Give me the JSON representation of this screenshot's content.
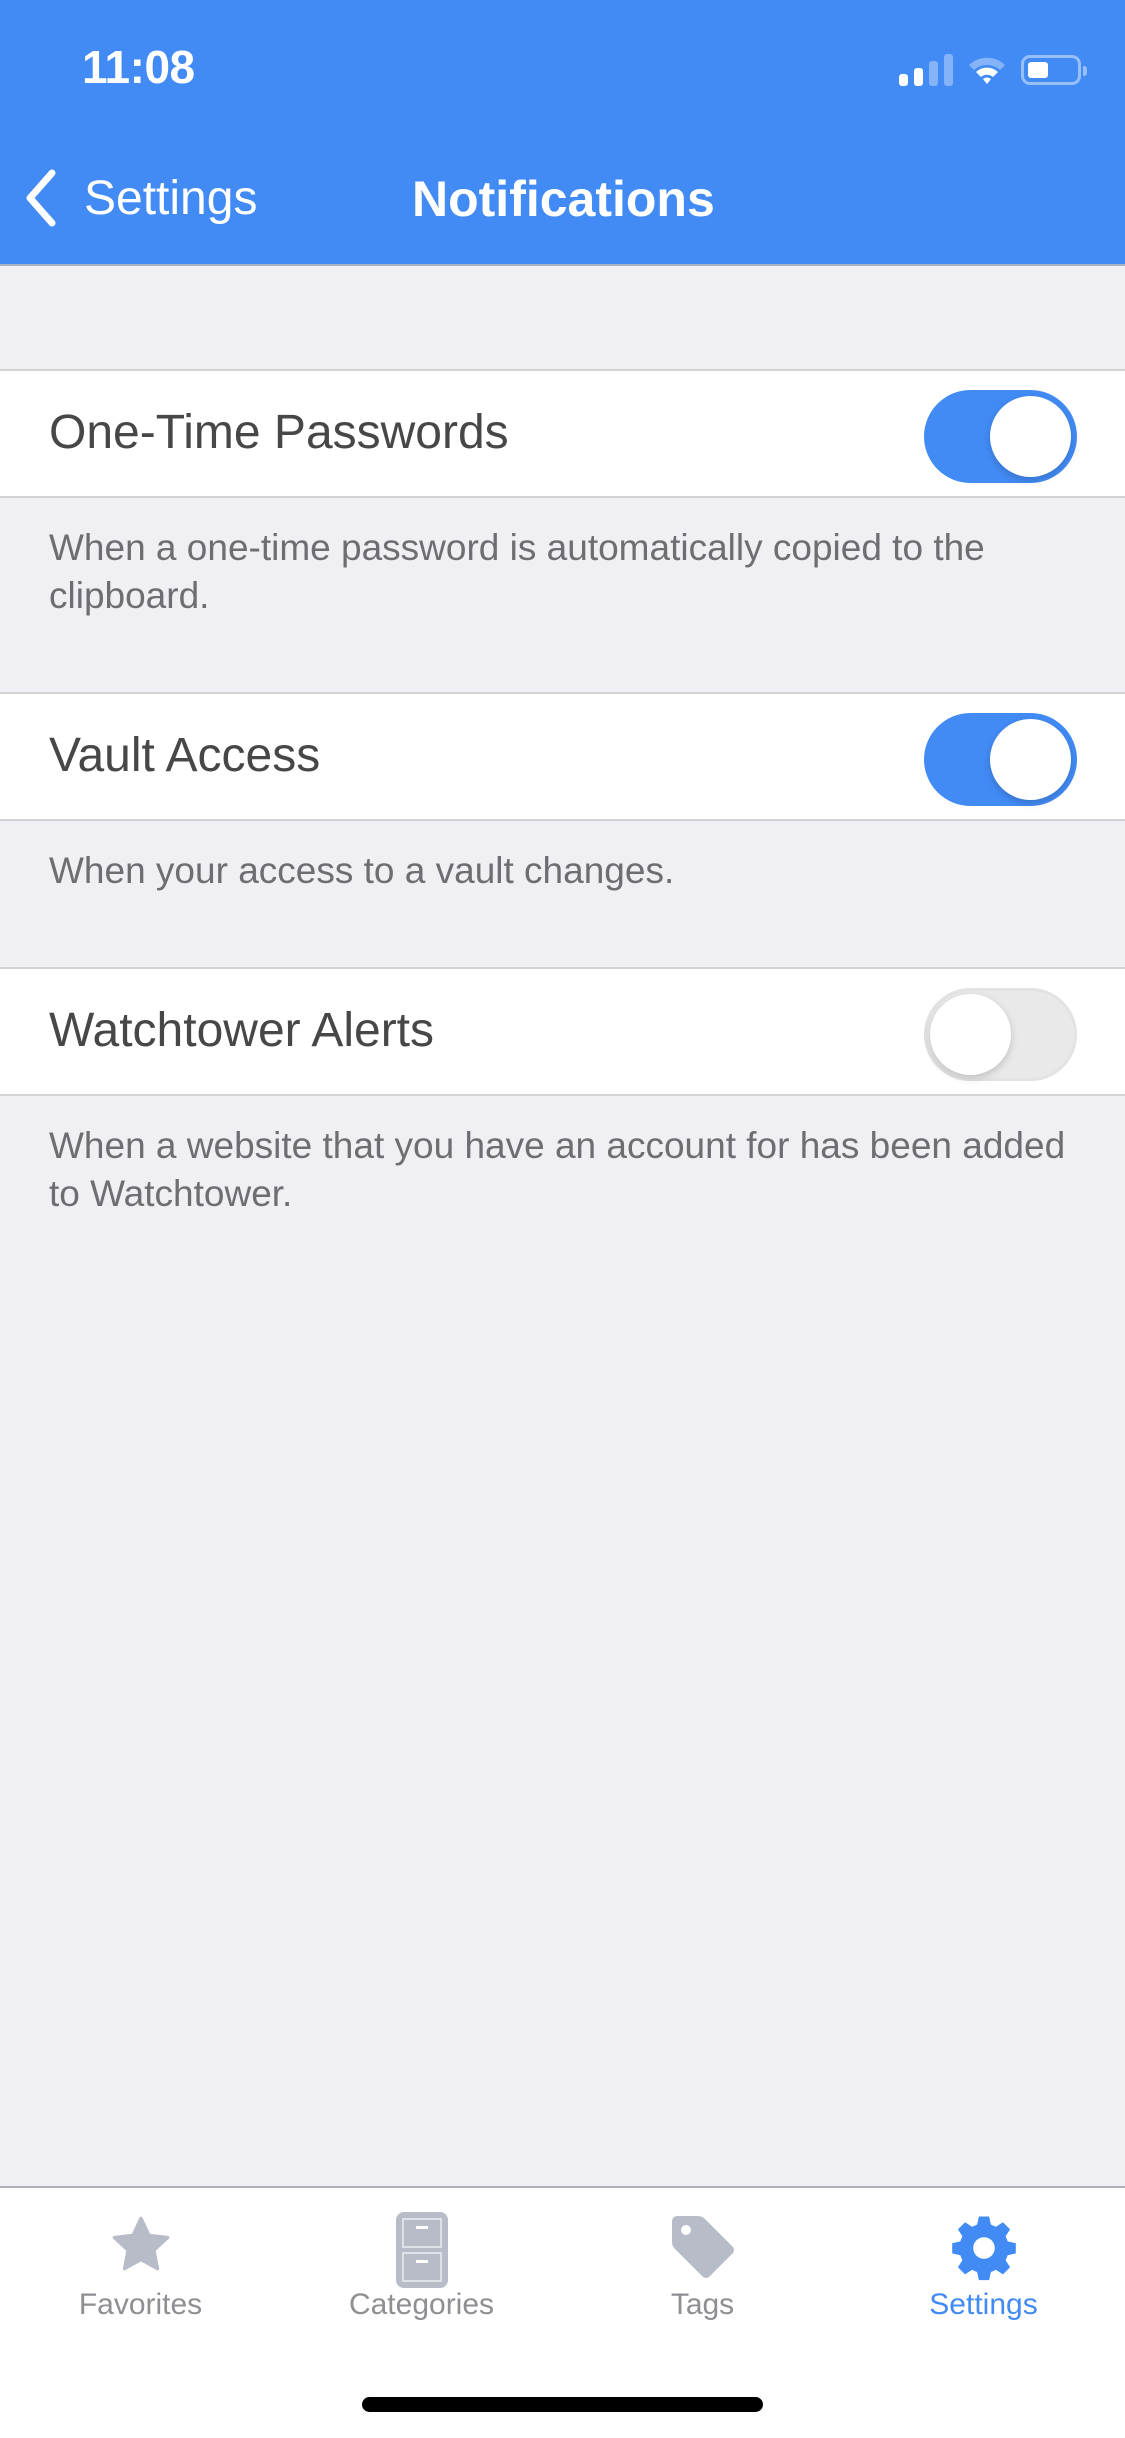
{
  "status_bar": {
    "time": "11:08",
    "icons": [
      "cellular-signal-icon",
      "wifi-icon",
      "battery-icon"
    ]
  },
  "nav": {
    "back_label": "Settings",
    "back_icon": "chevron-left-icon",
    "title": "Notifications"
  },
  "settings": [
    {
      "label": "One-Time Passwords",
      "enabled": true,
      "description": "When a one-time password is automatically copied to the clipboard."
    },
    {
      "label": "Vault Access",
      "enabled": true,
      "description": "When your access to a vault changes."
    },
    {
      "label": "Watchtower Alerts",
      "enabled": false,
      "description": "When a website that you have an account for has been added to Watchtower."
    }
  ],
  "tabbar": {
    "tabs": [
      {
        "label": "Favorites",
        "icon": "star-icon",
        "active": false
      },
      {
        "label": "Categories",
        "icon": "filing-cabinet-icon",
        "active": false
      },
      {
        "label": "Tags",
        "icon": "tag-icon",
        "active": false
      },
      {
        "label": "Settings",
        "icon": "gear-icon",
        "active": true
      }
    ]
  },
  "colors": {
    "accent": "#428bf5",
    "background": "#efeff4",
    "toggle_off": "#e9e9ea",
    "inactive_icon": "#b8bcc8",
    "inactive_label": "#8e8e93"
  }
}
